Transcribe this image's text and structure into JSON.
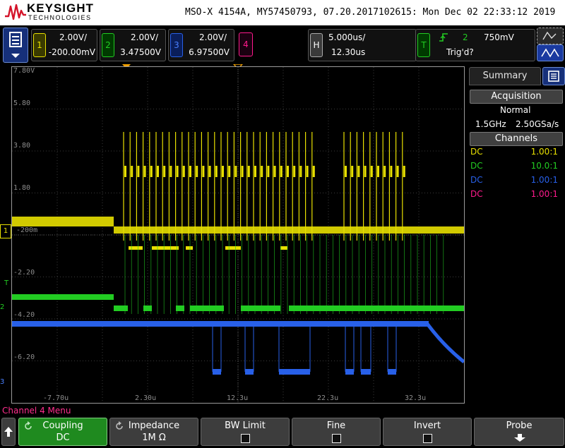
{
  "header": {
    "brand": "KEYSIGHT",
    "brand_sub": "TECHNOLOGIES",
    "instrument_line": "MSO-X 4154A, MY57450793, 07.20.2017102615: Mon Dec 02 22:33:12 2019"
  },
  "channels": [
    {
      "number": "1",
      "scale": "2.00V/",
      "offset": "-200.00mV",
      "color": "#e8e000"
    },
    {
      "number": "2",
      "scale": "2.00V/",
      "offset": "3.47500V",
      "color": "#22cc22"
    },
    {
      "number": "3",
      "scale": "2.00V/",
      "offset": "6.97500V",
      "color": "#2860e8"
    },
    {
      "number": "4",
      "color": "#ff1a8c"
    }
  ],
  "horizontal": {
    "key": "H",
    "scale": "5.000us/",
    "delay": "12.30us"
  },
  "trigger": {
    "key": "T",
    "slope_icon": "rising-edge-icon",
    "source": "2",
    "level": "750mV",
    "status": "Trig'd?"
  },
  "graticule": {
    "y_labels": [
      "7.80V",
      "5.80",
      "3.80",
      "1.80",
      "-200m",
      "-2.20",
      "-4.20",
      "-6.20"
    ],
    "x_labels": [
      "-7.70u",
      "2.30u",
      "12.3u",
      "22.3u",
      "32.3u"
    ]
  },
  "markers": {
    "ch1": "1",
    "ch2": "2",
    "ch3": "3",
    "trigger": "T"
  },
  "summary": {
    "tab_label": "Summary",
    "acquisition_header": "Acquisition",
    "mode": "Normal",
    "bandwidth": "1.5GHz",
    "sample_rate": "2.50GSa/s",
    "channels_header": "Channels",
    "rows": [
      {
        "coupling": "DC",
        "probe": "1.00:1",
        "color": "#e8e000"
      },
      {
        "coupling": "DC",
        "probe": "10.0:1",
        "color": "#22cc22"
      },
      {
        "coupling": "DC",
        "probe": "1.00:1",
        "color": "#2860e8"
      },
      {
        "coupling": "DC",
        "probe": "1.00:1",
        "color": "#ff1a8c"
      }
    ]
  },
  "menu": {
    "title": "Channel 4 Menu",
    "softkeys": [
      {
        "label": "Coupling",
        "value": "DC"
      },
      {
        "label": "Impedance",
        "value": "1M Ω"
      },
      {
        "label": "BW Limit"
      },
      {
        "label": "Fine"
      },
      {
        "label": "Invert"
      },
      {
        "label": "Probe"
      }
    ]
  }
}
